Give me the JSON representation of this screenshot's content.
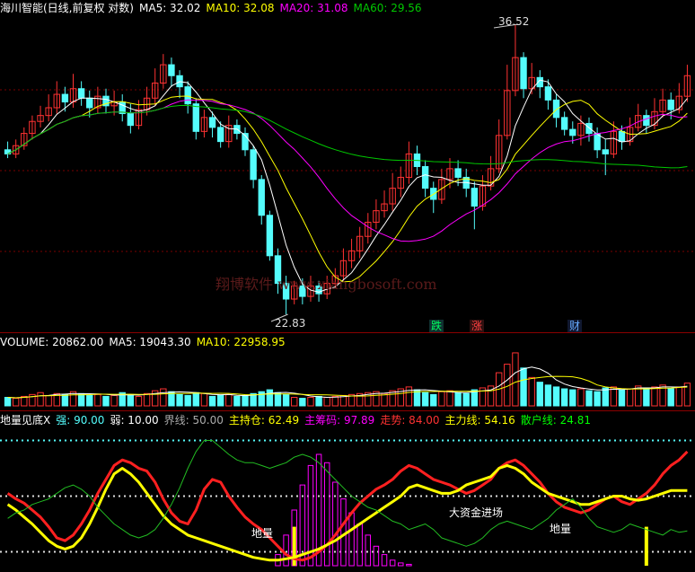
{
  "header_main": {
    "title": "海川智能(日线,前复权 对数)",
    "ma5": "MA5: 32.02",
    "ma10": "MA10: 32.08",
    "ma20": "MA20: 31.08",
    "ma60": "MA60: 29.56"
  },
  "annotations": {
    "high": "36.52",
    "low": "22.83",
    "watermark": "翔博软件 www.xiangbosoft.com",
    "die": "跌",
    "zhang": "涨",
    "cai": "财",
    "big_money": "大资金进场",
    "diliang1": "地量",
    "diliang2": "地量"
  },
  "header_volume": {
    "volume": "VOLUME: 20862.00",
    "ma5": "MA5: 19043.30",
    "ma10": "MA10: 22958.95"
  },
  "header_indicator": {
    "name": "地量见底X",
    "strong": "强: 90.00",
    "weak": "弱: 10.00",
    "boundary": "界线: 50.00",
    "holding": "主持仓: 62.49",
    "chips": "主筹码: 97.89",
    "trend": "走势: 84.00",
    "main_line": "主力线: 54.16",
    "retail_line": "散户线: 24.81"
  },
  "colors": {
    "up": "#ff3232",
    "down": "#54fcfc",
    "ma5": "#ffffff",
    "ma10": "#ffff00",
    "ma20": "#ff00ff",
    "ma60": "#00c800",
    "red_line": "#ff2020",
    "yellow_line": "#ffff00",
    "green_line": "#22bb22",
    "magenta_bar": "#ff00ff"
  },
  "chart_data": [
    {
      "type": "candlestick",
      "title": "海川智能(日线,前复权 对数)",
      "ylim": [
        22.5,
        37.0
      ],
      "high_label": 36.52,
      "low_label": 22.83,
      "candles": [
        [
          29.8,
          29.6,
          30.2,
          29.4
        ],
        [
          29.6,
          30.0,
          30.3,
          29.4
        ],
        [
          30.0,
          30.6,
          30.9,
          29.8
        ],
        [
          30.6,
          31.2,
          31.5,
          30.3
        ],
        [
          31.2,
          31.5,
          32.0,
          30.9
        ],
        [
          31.5,
          31.9,
          32.6,
          31.2
        ],
        [
          31.9,
          32.6,
          33.3,
          31.6
        ],
        [
          32.6,
          32.2,
          33.0,
          31.7
        ],
        [
          32.2,
          32.9,
          33.7,
          31.9
        ],
        [
          32.9,
          32.4,
          33.3,
          32.0
        ],
        [
          32.4,
          31.9,
          32.8,
          31.4
        ],
        [
          31.9,
          32.5,
          33.0,
          31.6
        ],
        [
          32.5,
          32.0,
          32.9,
          31.6
        ],
        [
          32.0,
          32.2,
          32.8,
          31.5
        ],
        [
          32.2,
          31.6,
          32.6,
          31.2
        ],
        [
          31.6,
          31.0,
          32.1,
          30.6
        ],
        [
          31.0,
          31.8,
          32.3,
          30.8
        ],
        [
          31.8,
          32.4,
          33.0,
          31.5
        ],
        [
          32.4,
          33.2,
          34.0,
          32.0
        ],
        [
          33.2,
          34.2,
          34.8,
          32.9
        ],
        [
          34.2,
          33.6,
          34.6,
          33.0
        ],
        [
          33.6,
          33.0,
          33.9,
          32.4
        ],
        [
          33.0,
          32.1,
          33.3,
          31.6
        ],
        [
          32.1,
          30.7,
          32.4,
          30.3
        ],
        [
          30.7,
          31.4,
          31.8,
          30.4
        ],
        [
          31.4,
          30.9,
          31.7,
          30.4
        ],
        [
          30.9,
          30.2,
          31.2,
          29.9
        ],
        [
          30.2,
          31.0,
          31.5,
          29.9
        ],
        [
          31.0,
          30.6,
          31.3,
          30.3
        ],
        [
          30.6,
          29.8,
          30.9,
          29.5
        ],
        [
          29.8,
          28.4,
          30.0,
          28.0
        ],
        [
          28.4,
          26.8,
          28.6,
          26.4
        ],
        [
          26.8,
          25.1,
          27.0,
          24.9
        ],
        [
          25.1,
          24.0,
          25.4,
          23.6
        ],
        [
          24.0,
          23.4,
          24.3,
          22.83
        ],
        [
          23.4,
          23.9,
          24.1,
          23.2
        ],
        [
          23.9,
          23.5,
          24.2,
          23.2
        ],
        [
          23.5,
          23.9,
          24.3,
          23.3
        ],
        [
          23.9,
          23.6,
          24.1,
          23.3
        ],
        [
          23.6,
          24.0,
          24.3,
          23.4
        ],
        [
          24.0,
          24.3,
          24.6,
          23.8
        ],
        [
          24.3,
          24.9,
          25.4,
          24.1
        ],
        [
          24.9,
          25.3,
          25.8,
          24.6
        ],
        [
          25.3,
          25.9,
          26.3,
          25.0
        ],
        [
          25.9,
          26.5,
          26.9,
          25.6
        ],
        [
          26.5,
          27.0,
          27.5,
          26.2
        ],
        [
          27.0,
          27.3,
          27.9,
          26.7
        ],
        [
          27.3,
          28.0,
          28.7,
          27.0
        ],
        [
          28.0,
          28.5,
          29.0,
          27.6
        ],
        [
          28.5,
          29.6,
          30.2,
          28.2
        ],
        [
          29.6,
          29.0,
          30.0,
          28.6
        ],
        [
          29.0,
          28.0,
          29.3,
          27.6
        ],
        [
          28.0,
          27.5,
          28.3,
          26.9
        ],
        [
          27.5,
          28.4,
          28.9,
          27.3
        ],
        [
          28.4,
          28.9,
          29.4,
          28.0
        ],
        [
          28.9,
          28.5,
          29.3,
          28.1
        ],
        [
          28.5,
          28.0,
          28.9,
          27.6
        ],
        [
          28.0,
          27.2,
          28.3,
          26.2
        ],
        [
          27.2,
          28.1,
          28.6,
          27.0
        ],
        [
          28.1,
          28.9,
          29.5,
          27.9
        ],
        [
          28.9,
          30.5,
          31.3,
          28.7
        ],
        [
          30.5,
          32.8,
          34.2,
          30.3
        ],
        [
          32.8,
          34.6,
          36.52,
          32.5
        ],
        [
          34.6,
          32.9,
          34.9,
          32.4
        ],
        [
          32.9,
          33.5,
          34.3,
          32.6
        ],
        [
          33.5,
          33.0,
          33.9,
          32.4
        ],
        [
          33.0,
          32.3,
          33.4,
          31.8
        ],
        [
          32.3,
          31.4,
          32.6,
          30.9
        ],
        [
          31.4,
          30.8,
          31.7,
          30.5
        ],
        [
          30.8,
          30.5,
          31.2,
          30.1
        ],
        [
          30.5,
          31.1,
          31.5,
          30.0
        ],
        [
          31.1,
          30.6,
          31.4,
          30.2
        ],
        [
          30.6,
          29.8,
          30.9,
          29.4
        ],
        [
          29.8,
          29.6,
          30.3,
          28.6
        ],
        [
          29.6,
          30.7,
          31.2,
          29.4
        ],
        [
          30.7,
          30.2,
          31.0,
          29.8
        ],
        [
          30.2,
          30.9,
          31.4,
          30.0
        ],
        [
          30.9,
          31.5,
          32.1,
          30.7
        ],
        [
          31.5,
          31.0,
          31.8,
          30.6
        ],
        [
          31.0,
          31.7,
          32.4,
          30.8
        ],
        [
          31.7,
          32.3,
          32.9,
          31.4
        ],
        [
          32.3,
          31.8,
          32.7,
          31.3
        ],
        [
          31.8,
          32.5,
          33.2,
          31.6
        ],
        [
          32.5,
          33.6,
          34.2,
          32.2
        ]
      ]
    },
    {
      "type": "bar",
      "title": "VOLUME",
      "values": [
        9,
        8,
        10,
        12,
        14,
        11,
        13,
        12,
        15,
        13,
        11,
        12,
        10,
        11,
        14,
        12,
        10,
        13,
        16,
        18,
        15,
        12,
        11,
        14,
        13,
        10,
        11,
        12,
        10,
        11,
        13,
        15,
        17,
        14,
        12,
        9,
        8,
        9,
        10,
        9,
        10,
        11,
        12,
        13,
        14,
        15,
        13,
        16,
        18,
        20,
        17,
        14,
        12,
        15,
        16,
        14,
        13,
        17,
        19,
        21,
        35,
        44,
        56,
        40,
        30,
        25,
        22,
        20,
        18,
        17,
        18,
        16,
        15,
        19,
        20,
        17,
        18,
        21,
        19,
        20,
        22,
        18,
        20,
        24
      ]
    },
    {
      "type": "line",
      "title": "地量见底X",
      "ylim": [
        0,
        100
      ],
      "levels": {
        "strong": 90,
        "weak": 10,
        "boundary": 50
      },
      "series": [
        {
          "name": "主持仓",
          "values": [
            52,
            48,
            45,
            40,
            35,
            28,
            20,
            18,
            22,
            30,
            40,
            52,
            62,
            72,
            76,
            74,
            70,
            68,
            60,
            48,
            38,
            32,
            30,
            40,
            55,
            62,
            60,
            50,
            42,
            35,
            30,
            26,
            20,
            14,
            8,
            5,
            4,
            6,
            10,
            15,
            22,
            30,
            38,
            45,
            50,
            55,
            58,
            62,
            68,
            72,
            70,
            66,
            62,
            60,
            58,
            55,
            52,
            54,
            58,
            62,
            70,
            74,
            76,
            72,
            66,
            60,
            52,
            46,
            42,
            40,
            38,
            40,
            44,
            48,
            50,
            46,
            44,
            48,
            52,
            58,
            66,
            72,
            76,
            82
          ]
        },
        {
          "name": "主力线",
          "values": [
            44,
            40,
            35,
            30,
            24,
            18,
            14,
            12,
            14,
            20,
            30,
            42,
            55,
            66,
            70,
            66,
            60,
            52,
            44,
            36,
            30,
            26,
            22,
            20,
            18,
            16,
            14,
            12,
            10,
            8,
            6,
            5,
            4,
            4,
            5,
            6,
            8,
            10,
            12,
            15,
            18,
            22,
            26,
            30,
            34,
            38,
            42,
            46,
            50,
            56,
            58,
            56,
            54,
            52,
            52,
            54,
            58,
            60,
            62,
            64,
            70,
            72,
            70,
            66,
            60,
            56,
            52,
            50,
            48,
            46,
            44,
            44,
            46,
            48,
            50,
            50,
            48,
            47,
            48,
            50,
            52,
            54,
            54,
            54
          ]
        },
        {
          "name": "散户线",
          "values": [
            34,
            38,
            40,
            44,
            46,
            48,
            52,
            56,
            58,
            55,
            50,
            42,
            36,
            30,
            26,
            22,
            20,
            22,
            26,
            34,
            44,
            56,
            70,
            82,
            90,
            90,
            85,
            80,
            76,
            74,
            74,
            72,
            70,
            72,
            74,
            78,
            80,
            78,
            74,
            68,
            62,
            56,
            50,
            46,
            42,
            40,
            36,
            32,
            30,
            26,
            28,
            30,
            26,
            20,
            18,
            16,
            14,
            16,
            20,
            26,
            30,
            32,
            30,
            28,
            26,
            30,
            34,
            40,
            44,
            48,
            42,
            34,
            28,
            26,
            24,
            26,
            30,
            28,
            26,
            24,
            22,
            26,
            24,
            25
          ]
        }
      ],
      "bars": [
        0,
        0,
        0,
        0,
        0,
        0,
        0,
        0,
        0,
        0,
        0,
        0,
        0,
        0,
        0,
        0,
        0,
        0,
        0,
        0,
        0,
        0,
        0,
        0,
        0,
        0,
        0,
        0,
        0,
        0,
        0,
        0,
        0,
        8,
        22,
        40,
        58,
        72,
        80,
        74,
        60,
        48,
        38,
        30,
        22,
        14,
        8,
        4,
        2,
        1,
        0,
        0,
        0,
        0,
        0,
        0,
        0,
        0,
        0,
        0,
        0,
        0,
        0,
        0,
        0,
        0,
        0,
        0,
        0,
        0,
        0,
        0,
        0,
        0,
        0,
        0,
        0,
        0,
        0,
        0,
        0,
        0,
        0,
        0
      ]
    }
  ]
}
